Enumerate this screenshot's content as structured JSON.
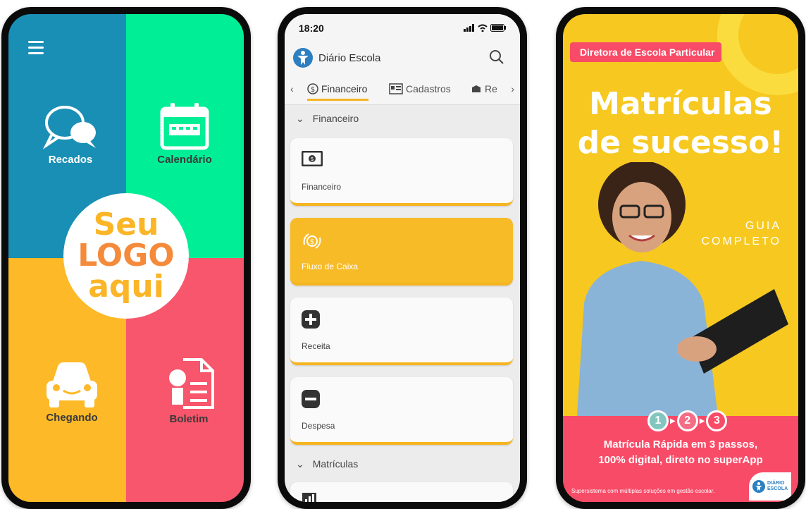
{
  "phone1": {
    "tiles": [
      {
        "label": "Recados",
        "icon": "chat-bubbles-icon"
      },
      {
        "label": "Calendário",
        "icon": "calendar-icon"
      },
      {
        "label": "Chegando",
        "icon": "car-icon"
      },
      {
        "label": "Boletim",
        "icon": "report-card-icon"
      }
    ],
    "logo_lines": [
      "Seu",
      "LOGO",
      "aqui"
    ],
    "colors": {
      "teal": "#1a8fb5",
      "green": "#00ee96",
      "yellow": "#fdb927",
      "coral": "#f7566c"
    }
  },
  "phone2": {
    "status_time": "18:20",
    "app_name": "Diário Escola",
    "tabs": [
      "Financeiro",
      "Cadastros",
      "Re"
    ],
    "section1": "Financeiro",
    "cards": [
      {
        "label": "Financeiro",
        "icon": "money-icon",
        "active": false
      },
      {
        "label": "Fluxo de Caixa",
        "icon": "cash-flow-icon",
        "active": true
      },
      {
        "label": "Receita",
        "icon": "plus-icon",
        "active": false
      },
      {
        "label": "Despesa",
        "icon": "minus-icon",
        "active": false
      }
    ],
    "section2": "Matrículas",
    "accent": "#f5b521"
  },
  "phone3": {
    "badge": "Diretora de Escola Particular",
    "headline_1": "Matrículas",
    "headline_2": "de sucesso!",
    "guia_1": "GUIA",
    "guia_2": "COMPLETO",
    "steps": [
      "1",
      "2",
      "3"
    ],
    "promo_1": "Matrícula Rápida em 3 passos,",
    "promo_2": "100% digital, direto no superApp",
    "footer": "Supersistema com múltiplas soluções em gestão escolar.",
    "brand": "DIÁRIO ESCOLA",
    "colors": {
      "yellow": "#f6c820",
      "pink": "#f84b67"
    }
  }
}
